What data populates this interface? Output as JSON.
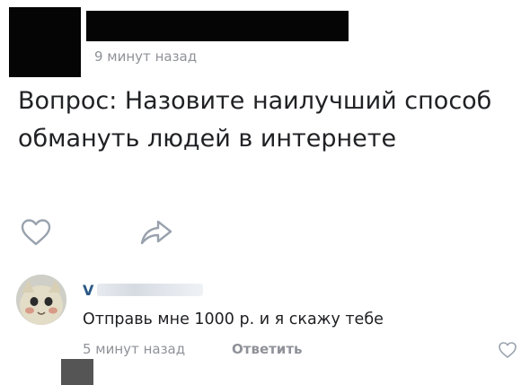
{
  "post": {
    "author_name": "",
    "time": "9 минут назад",
    "text": "Вопрос: Назовите наилучший способ обмануть людей в интернете",
    "actions": {
      "like_icon": "heart-outline-icon",
      "share_icon": "share-arrow-icon"
    }
  },
  "comment": {
    "author_visible": "V",
    "text": "Отправь мне 1000 р. и я скажу тебе",
    "time": "5 минут назад",
    "reply_label": "Ответить",
    "like_icon": "heart-outline-icon"
  },
  "colors": {
    "text": "#202124",
    "meta": "#8f9298",
    "author_link": "#2a5885",
    "icon_outline": "#99a2ad",
    "redaction": "#050505"
  }
}
